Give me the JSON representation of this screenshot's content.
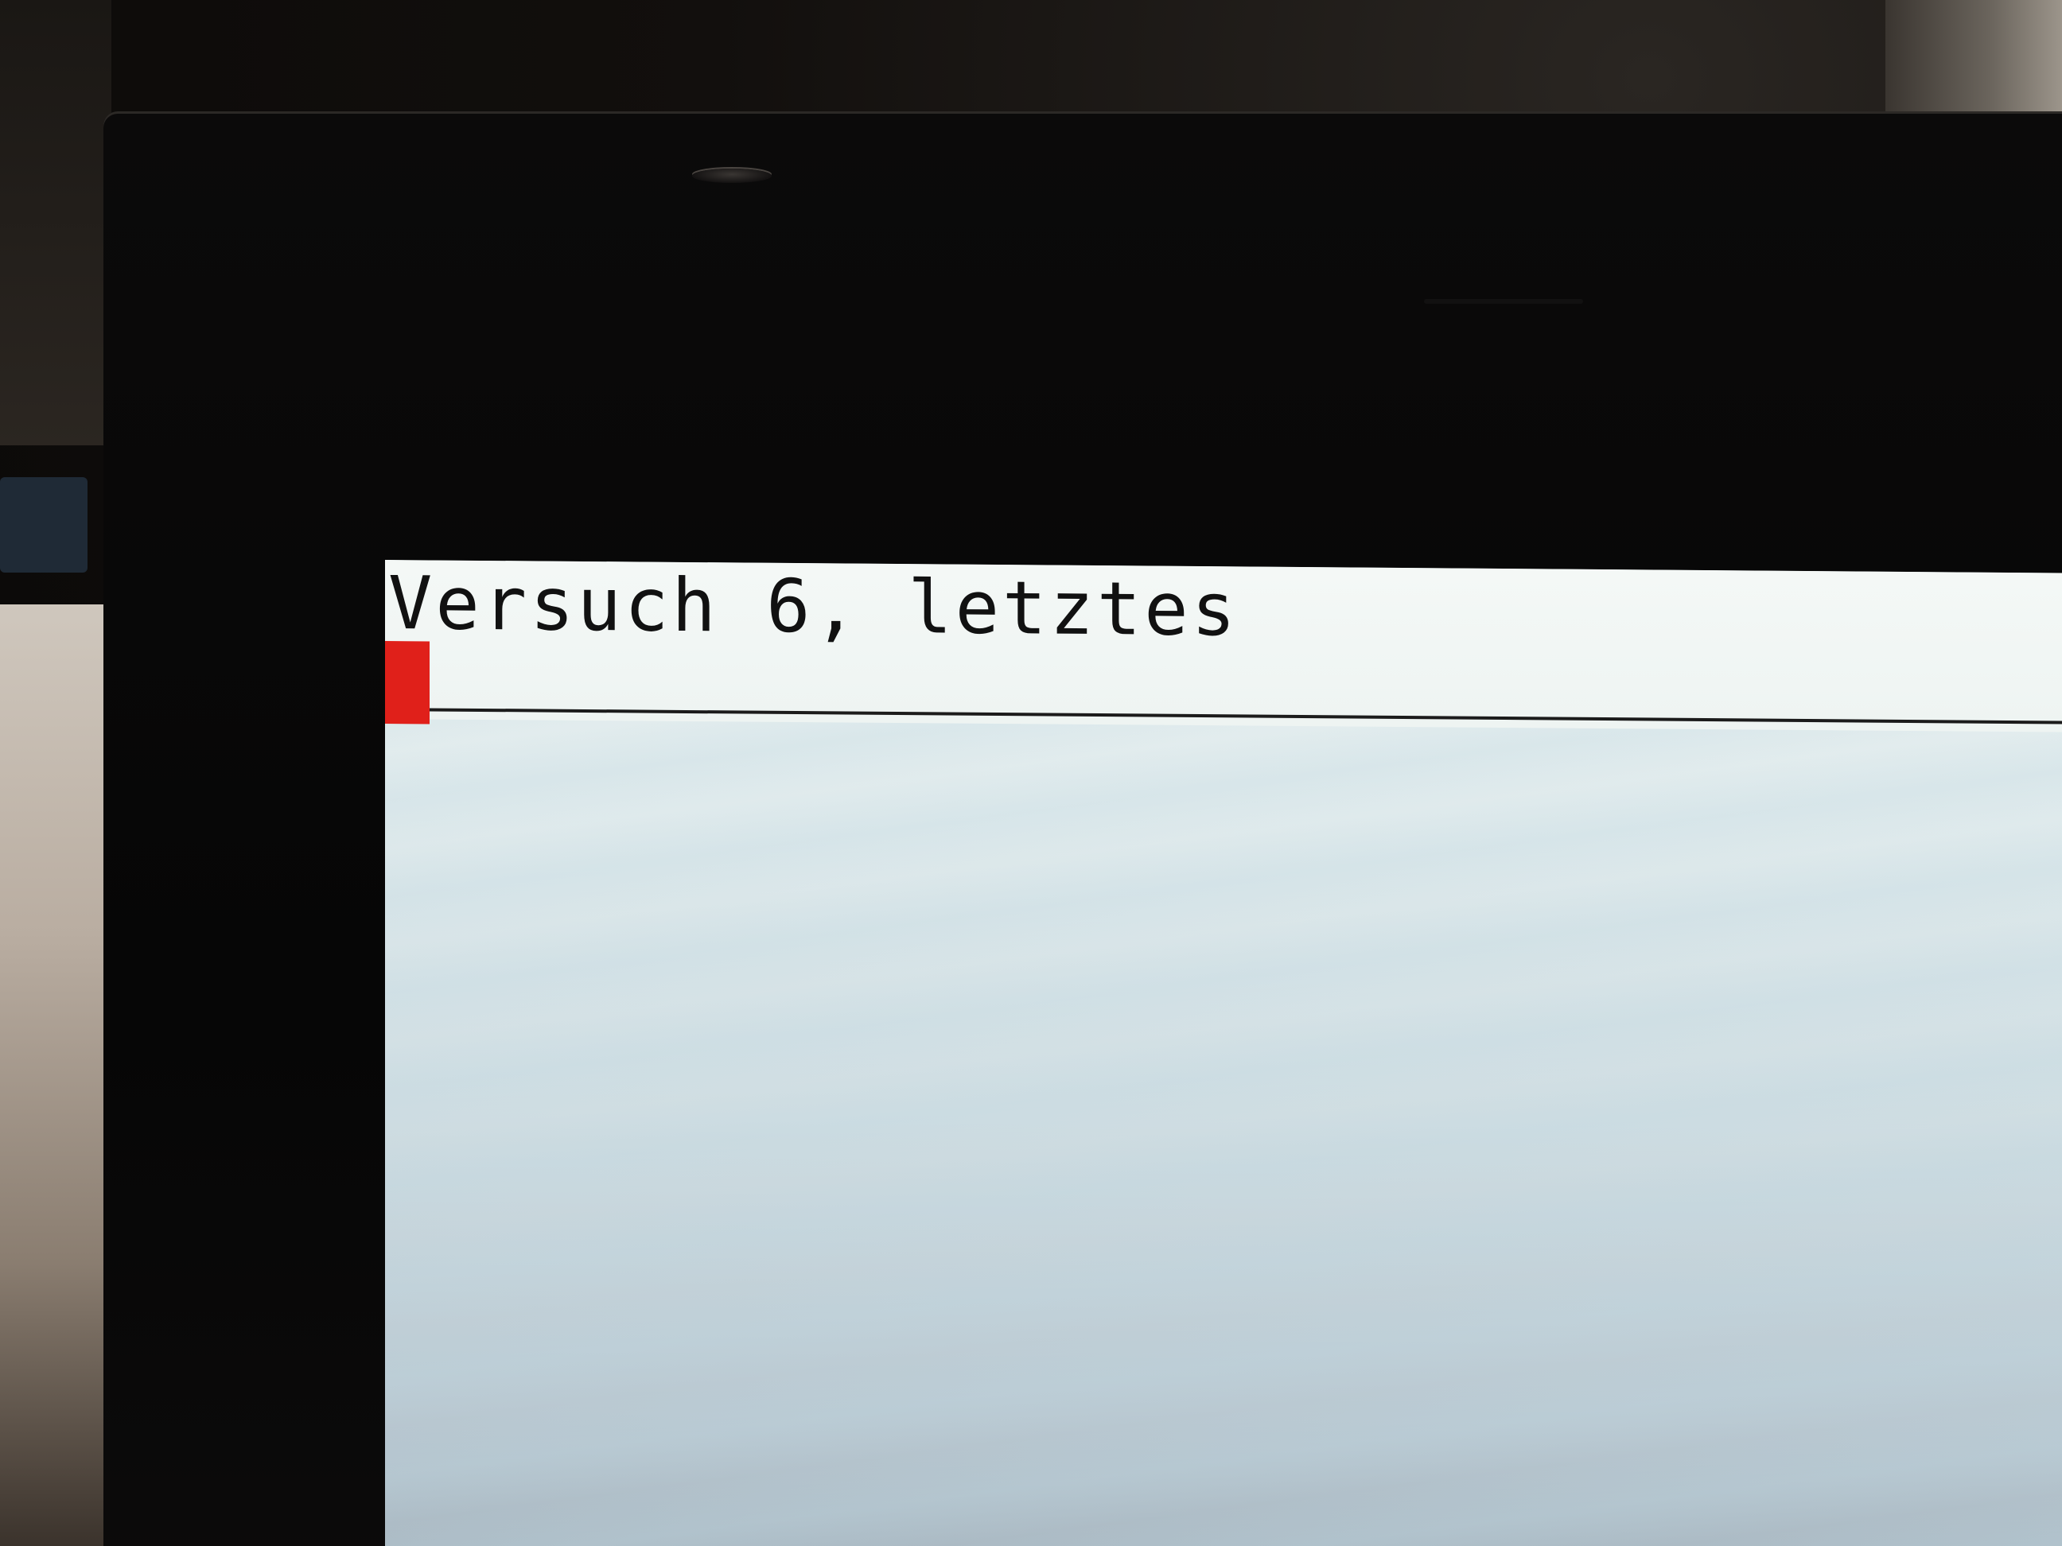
{
  "terminal": {
    "line1": "Versuch 6, letztes",
    "cursor_color": "#e0201a"
  },
  "colors": {
    "screen_background": "#e9f1f1",
    "text": "#111111",
    "bezel": "#080707"
  }
}
